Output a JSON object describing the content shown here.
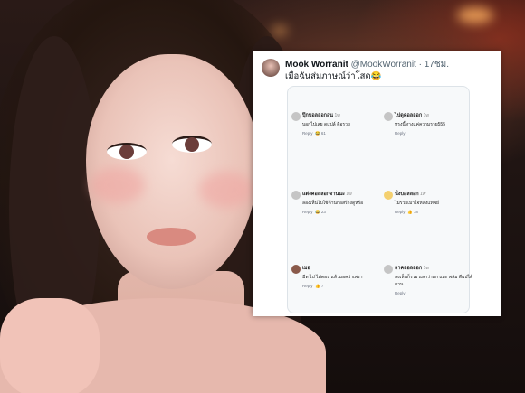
{
  "tweet": {
    "display_name": "Mook Worranit",
    "handle": "@MookWorranit · 17ชม.",
    "text": "เมื่อฉันส่มภาษณ์ว่าโสด😂"
  },
  "comments": [
    {
      "user": "ปุ๊กบอลลอกอน",
      "ago": "1w",
      "text": "บอกไปเลย ดแปล์ คือรวย",
      "reply": "Reply",
      "likes": "61"
    },
    {
      "user": "ไปดูคอลลอก",
      "ago": "1w",
      "text": "ทรงนี้ทางแค่ความรวย555",
      "reply": "Reply",
      "likes": ""
    },
    {
      "user": "แต่งคอลลอกจานนะ",
      "ago": "1w",
      "text": "ลองเห็นไปใช้ด้านก่อสร้างดูหรือ",
      "reply": "Reply",
      "likes": "23"
    },
    {
      "user": "นั่งบอลลอก",
      "ago": "1w",
      "text": "ไม่รวยเมาใจหลงแทพย์",
      "reply": "Reply",
      "likes": "18"
    },
    {
      "user": "เมอ",
      "ago": "",
      "text": "มีท ไป ไม่ตอบ แล้วมอคว่าเพรา",
      "reply": "Reply",
      "likes": "7"
    },
    {
      "user": "ลาคลอลลอก",
      "ago": "1w",
      "text": "ลงเห็นก็รวย แลกว่ามก และ พล่ม ดีแปได้ตาน",
      "reply": "Reply",
      "likes": ""
    }
  ]
}
